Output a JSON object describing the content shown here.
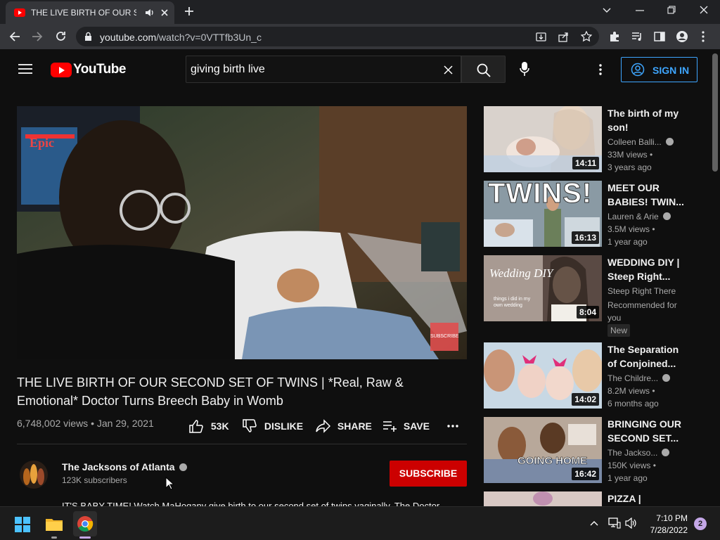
{
  "browser": {
    "tab_title": "THE LIVE BIRTH OF OUR SEC",
    "url_domain": "youtube.com",
    "url_path": "/watch?v=0VTTfb3Un_c"
  },
  "youtube": {
    "logo_text": "YouTube",
    "search_value": "giving birth live",
    "signin_label": "SIGN IN",
    "video": {
      "title": "THE LIVE BIRTH OF OUR SECOND SET OF TWINS | *Real, Raw & Emotional* Doctor Turns Breech Baby in Womb",
      "views": "6,748,002 views",
      "date": "Jan 29, 2021",
      "likes": "53K",
      "dislike_label": "DISLIKE",
      "share_label": "SHARE",
      "save_label": "SAVE",
      "watermark": "SUBSCRIBE",
      "monitor_text": "Epic"
    },
    "channel": {
      "name": "The Jacksons of Atlanta",
      "subscribers": "123K subscribers",
      "subscribe_label": "SUBSCRIBE",
      "description": "IT'S BABY TIME! Watch MaHogany give birth to our second set of twins vaginally. The Doctor"
    },
    "recommendations": [
      {
        "title": "The birth of my son!",
        "channel": "Colleen Balli...",
        "views": "33M views",
        "age": "3 years ago",
        "duration": "14:11"
      },
      {
        "title": "MEET OUR BABIES! TWIN...",
        "channel": "Lauren & Arie",
        "views": "3.5M views",
        "age": "1 year ago",
        "duration": "16:13",
        "thumb_text": "TWINS!"
      },
      {
        "title": "WEDDING DIY | Steep Right...",
        "channel": "Steep Right There",
        "views": "Recommended for you",
        "age": "",
        "duration": "8:04",
        "badge": "New",
        "thumb_text": "Wedding DIY",
        "thumb_sub": "things i did in my own wedding"
      },
      {
        "title": "The Separation of Conjoined...",
        "channel": "The Childre...",
        "views": "8.2M views",
        "age": "6 months ago",
        "duration": "14:02"
      },
      {
        "title": "BRINGING OUR SECOND SET...",
        "channel": "The Jackso...",
        "views": "150K views",
        "age": "1 year ago",
        "duration": "16:42",
        "thumb_text": "GOING HOME"
      },
      {
        "title": "PIZZA |",
        "channel": "",
        "views": "",
        "age": "",
        "duration": ""
      }
    ]
  },
  "taskbar": {
    "time": "7:10 PM",
    "date": "7/28/2022",
    "notification_count": "2"
  }
}
